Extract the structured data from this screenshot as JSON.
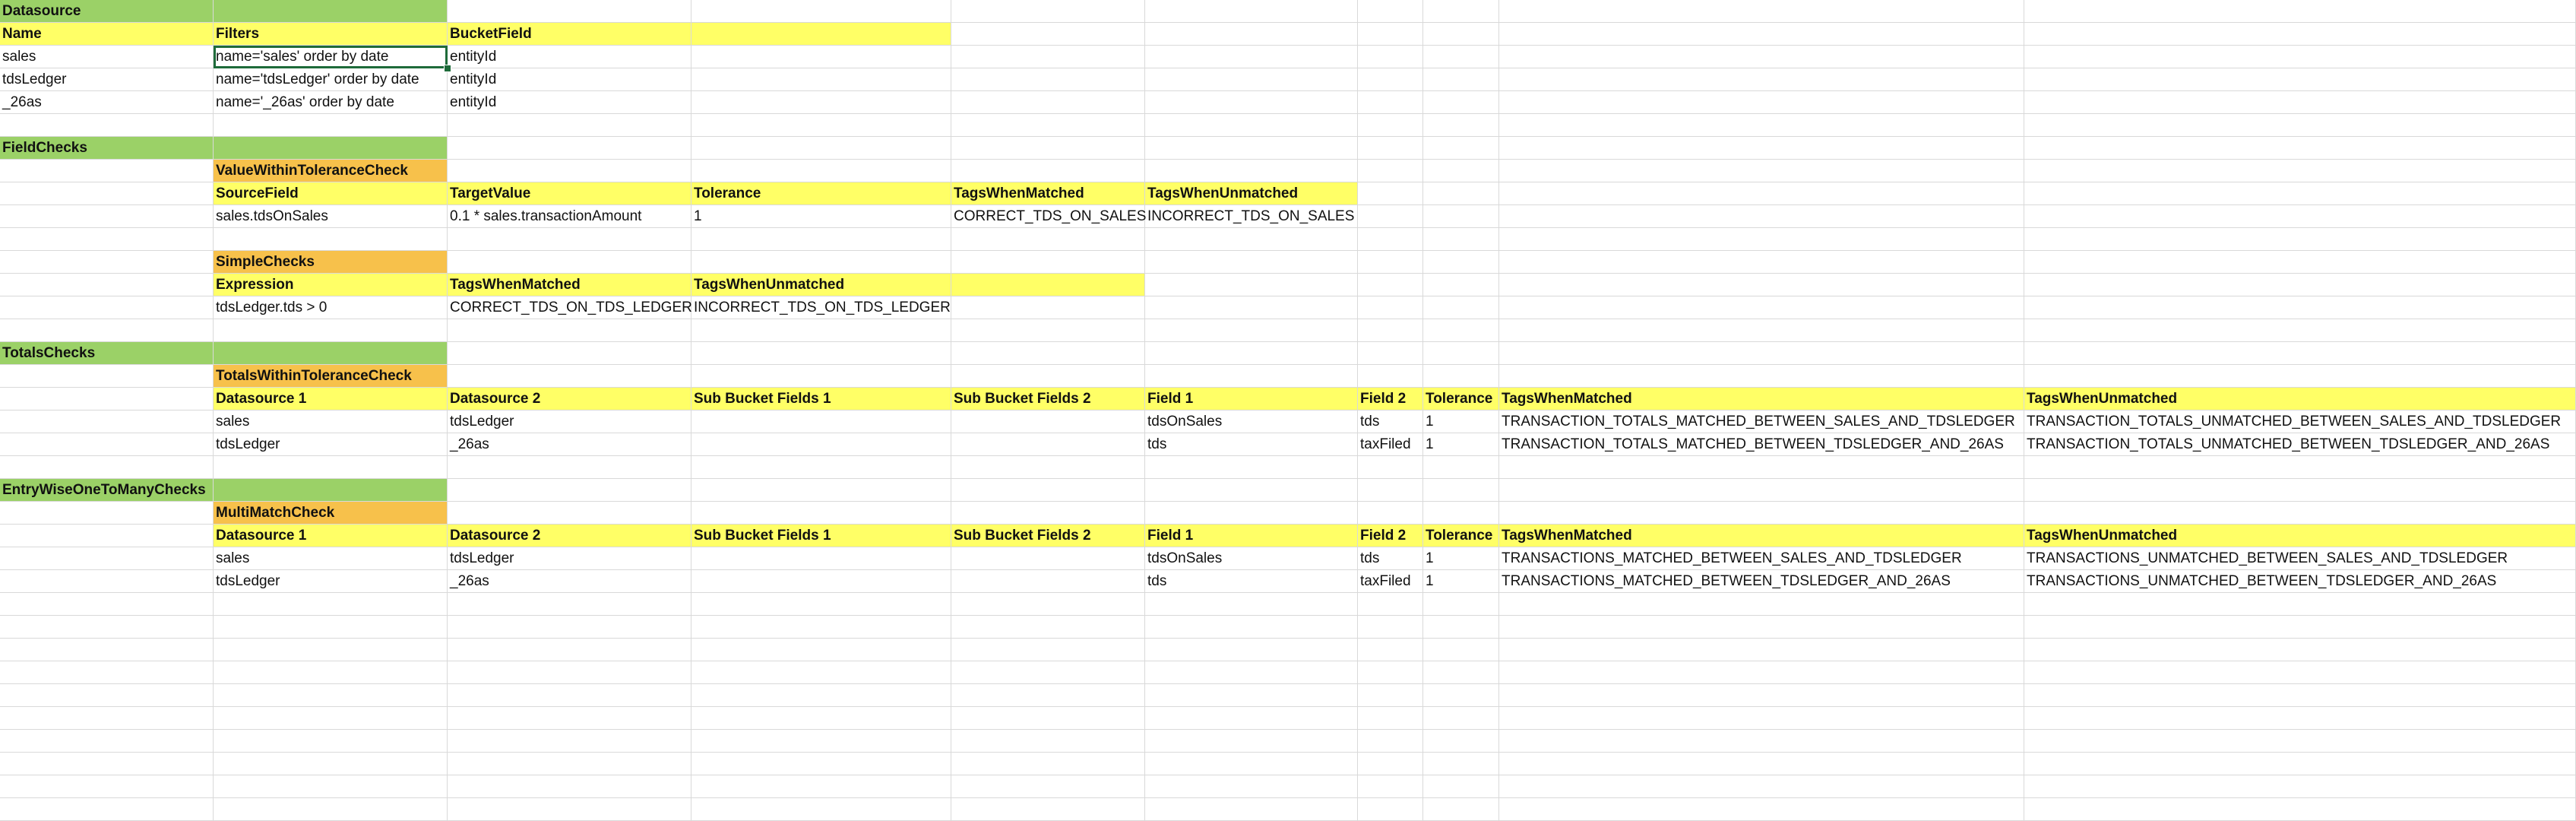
{
  "colors": {
    "section": "#9bd167",
    "header": "#ffff66",
    "check": "#f7c14b",
    "grid": "#d9d9d9",
    "selection": "#1e6b3a"
  },
  "selected_cell": "B3",
  "rows": [
    {
      "cells": [
        {
          "t": "Datasource",
          "fill": "section",
          "bold": true
        },
        {
          "t": "",
          "fill": "section"
        }
      ]
    },
    {
      "cells": [
        {
          "t": "Name",
          "fill": "header",
          "bold": true
        },
        {
          "t": "Filters",
          "fill": "header",
          "bold": true
        },
        {
          "t": "BucketField",
          "fill": "header",
          "bold": true
        },
        {
          "t": "",
          "fill": "header"
        }
      ]
    },
    {
      "cells": [
        {
          "t": "sales"
        },
        {
          "t": "name='sales' order by date"
        },
        {
          "t": "entityId"
        }
      ]
    },
    {
      "cells": [
        {
          "t": "tdsLedger"
        },
        {
          "t": "name='tdsLedger' order by date"
        },
        {
          "t": "entityId"
        }
      ]
    },
    {
      "cells": [
        {
          "t": "_26as"
        },
        {
          "t": "name='_26as' order by date"
        },
        {
          "t": "entityId"
        }
      ]
    },
    {
      "cells": []
    },
    {
      "cells": [
        {
          "t": "FieldChecks",
          "fill": "section",
          "bold": true
        },
        {
          "t": "",
          "fill": "section"
        }
      ]
    },
    {
      "cells": [
        {
          "t": ""
        },
        {
          "t": "ValueWithinToleranceCheck",
          "fill": "check",
          "bold": true
        }
      ]
    },
    {
      "cells": [
        {
          "t": ""
        },
        {
          "t": "SourceField",
          "fill": "header",
          "bold": true
        },
        {
          "t": "TargetValue",
          "fill": "header",
          "bold": true
        },
        {
          "t": "Tolerance",
          "fill": "header",
          "bold": true
        },
        {
          "t": "TagsWhenMatched",
          "fill": "header",
          "bold": true
        },
        {
          "t": "TagsWhenUnmatched",
          "fill": "header",
          "bold": true
        }
      ]
    },
    {
      "cells": [
        {
          "t": ""
        },
        {
          "t": "sales.tdsOnSales"
        },
        {
          "t": "0.1 * sales.transactionAmount"
        },
        {
          "t": "1"
        },
        {
          "t": "CORRECT_TDS_ON_SALES"
        },
        {
          "t": "INCORRECT_TDS_ON_SALES"
        }
      ]
    },
    {
      "cells": []
    },
    {
      "cells": [
        {
          "t": ""
        },
        {
          "t": "SimpleChecks",
          "fill": "check",
          "bold": true
        }
      ]
    },
    {
      "cells": [
        {
          "t": ""
        },
        {
          "t": "Expression",
          "fill": "header",
          "bold": true
        },
        {
          "t": "TagsWhenMatched",
          "fill": "header",
          "bold": true
        },
        {
          "t": "TagsWhenUnmatched",
          "fill": "header",
          "bold": true
        },
        {
          "t": "",
          "fill": "header"
        }
      ]
    },
    {
      "cells": [
        {
          "t": ""
        },
        {
          "t": "tdsLedger.tds > 0"
        },
        {
          "t": "CORRECT_TDS_ON_TDS_LEDGER"
        },
        {
          "t": "INCORRECT_TDS_ON_TDS_LEDGER"
        }
      ]
    },
    {
      "cells": []
    },
    {
      "cells": [
        {
          "t": "TotalsChecks",
          "fill": "section",
          "bold": true
        },
        {
          "t": "",
          "fill": "section"
        }
      ]
    },
    {
      "cells": [
        {
          "t": ""
        },
        {
          "t": "TotalsWithinToleranceCheck",
          "fill": "check",
          "bold": true
        }
      ]
    },
    {
      "cells": [
        {
          "t": ""
        },
        {
          "t": "Datasource 1",
          "fill": "header",
          "bold": true
        },
        {
          "t": "Datasource 2",
          "fill": "header",
          "bold": true
        },
        {
          "t": "Sub Bucket Fields 1",
          "fill": "header",
          "bold": true
        },
        {
          "t": "Sub Bucket Fields 2",
          "fill": "header",
          "bold": true
        },
        {
          "t": "Field 1",
          "fill": "header",
          "bold": true
        },
        {
          "t": "Field 2",
          "fill": "header",
          "bold": true
        },
        {
          "t": "Tolerance",
          "fill": "header",
          "bold": true
        },
        {
          "t": "TagsWhenMatched",
          "fill": "header",
          "bold": true
        },
        {
          "t": "TagsWhenUnmatched",
          "fill": "header",
          "bold": true
        }
      ]
    },
    {
      "cells": [
        {
          "t": ""
        },
        {
          "t": "sales"
        },
        {
          "t": "tdsLedger"
        },
        {
          "t": ""
        },
        {
          "t": ""
        },
        {
          "t": "tdsOnSales"
        },
        {
          "t": "tds"
        },
        {
          "t": "1"
        },
        {
          "t": "TRANSACTION_TOTALS_MATCHED_BETWEEN_SALES_AND_TDSLEDGER"
        },
        {
          "t": "TRANSACTION_TOTALS_UNMATCHED_BETWEEN_SALES_AND_TDSLEDGER"
        }
      ]
    },
    {
      "cells": [
        {
          "t": ""
        },
        {
          "t": "tdsLedger"
        },
        {
          "t": "_26as"
        },
        {
          "t": ""
        },
        {
          "t": ""
        },
        {
          "t": "tds"
        },
        {
          "t": "taxFiled"
        },
        {
          "t": "1"
        },
        {
          "t": "TRANSACTION_TOTALS_MATCHED_BETWEEN_TDSLEDGER_AND_26AS"
        },
        {
          "t": "TRANSACTION_TOTALS_UNMATCHED_BETWEEN_TDSLEDGER_AND_26AS"
        }
      ]
    },
    {
      "cells": []
    },
    {
      "cells": [
        {
          "t": "EntryWiseOneToManyChecks",
          "fill": "section",
          "bold": true
        },
        {
          "t": "",
          "fill": "section"
        }
      ]
    },
    {
      "cells": [
        {
          "t": ""
        },
        {
          "t": "MultiMatchCheck",
          "fill": "check",
          "bold": true
        }
      ]
    },
    {
      "cells": [
        {
          "t": ""
        },
        {
          "t": "Datasource 1",
          "fill": "header",
          "bold": true
        },
        {
          "t": "Datasource 2",
          "fill": "header",
          "bold": true
        },
        {
          "t": "Sub Bucket Fields 1",
          "fill": "header",
          "bold": true
        },
        {
          "t": "Sub Bucket Fields 2",
          "fill": "header",
          "bold": true
        },
        {
          "t": "Field 1",
          "fill": "header",
          "bold": true
        },
        {
          "t": "Field 2",
          "fill": "header",
          "bold": true
        },
        {
          "t": "Tolerance",
          "fill": "header",
          "bold": true
        },
        {
          "t": "TagsWhenMatched",
          "fill": "header",
          "bold": true
        },
        {
          "t": "TagsWhenUnmatched",
          "fill": "header",
          "bold": true
        }
      ]
    },
    {
      "cells": [
        {
          "t": ""
        },
        {
          "t": "sales"
        },
        {
          "t": "tdsLedger"
        },
        {
          "t": ""
        },
        {
          "t": ""
        },
        {
          "t": "tdsOnSales"
        },
        {
          "t": "tds"
        },
        {
          "t": "1"
        },
        {
          "t": "TRANSACTIONS_MATCHED_BETWEEN_SALES_AND_TDSLEDGER"
        },
        {
          "t": "TRANSACTIONS_UNMATCHED_BETWEEN_SALES_AND_TDSLEDGER"
        }
      ]
    },
    {
      "cells": [
        {
          "t": ""
        },
        {
          "t": "tdsLedger"
        },
        {
          "t": "_26as"
        },
        {
          "t": ""
        },
        {
          "t": ""
        },
        {
          "t": "tds"
        },
        {
          "t": "taxFiled"
        },
        {
          "t": "1"
        },
        {
          "t": "TRANSACTIONS_MATCHED_BETWEEN_TDSLEDGER_AND_26AS"
        },
        {
          "t": "TRANSACTIONS_UNMATCHED_BETWEEN_TDSLEDGER_AND_26AS"
        }
      ]
    }
  ]
}
